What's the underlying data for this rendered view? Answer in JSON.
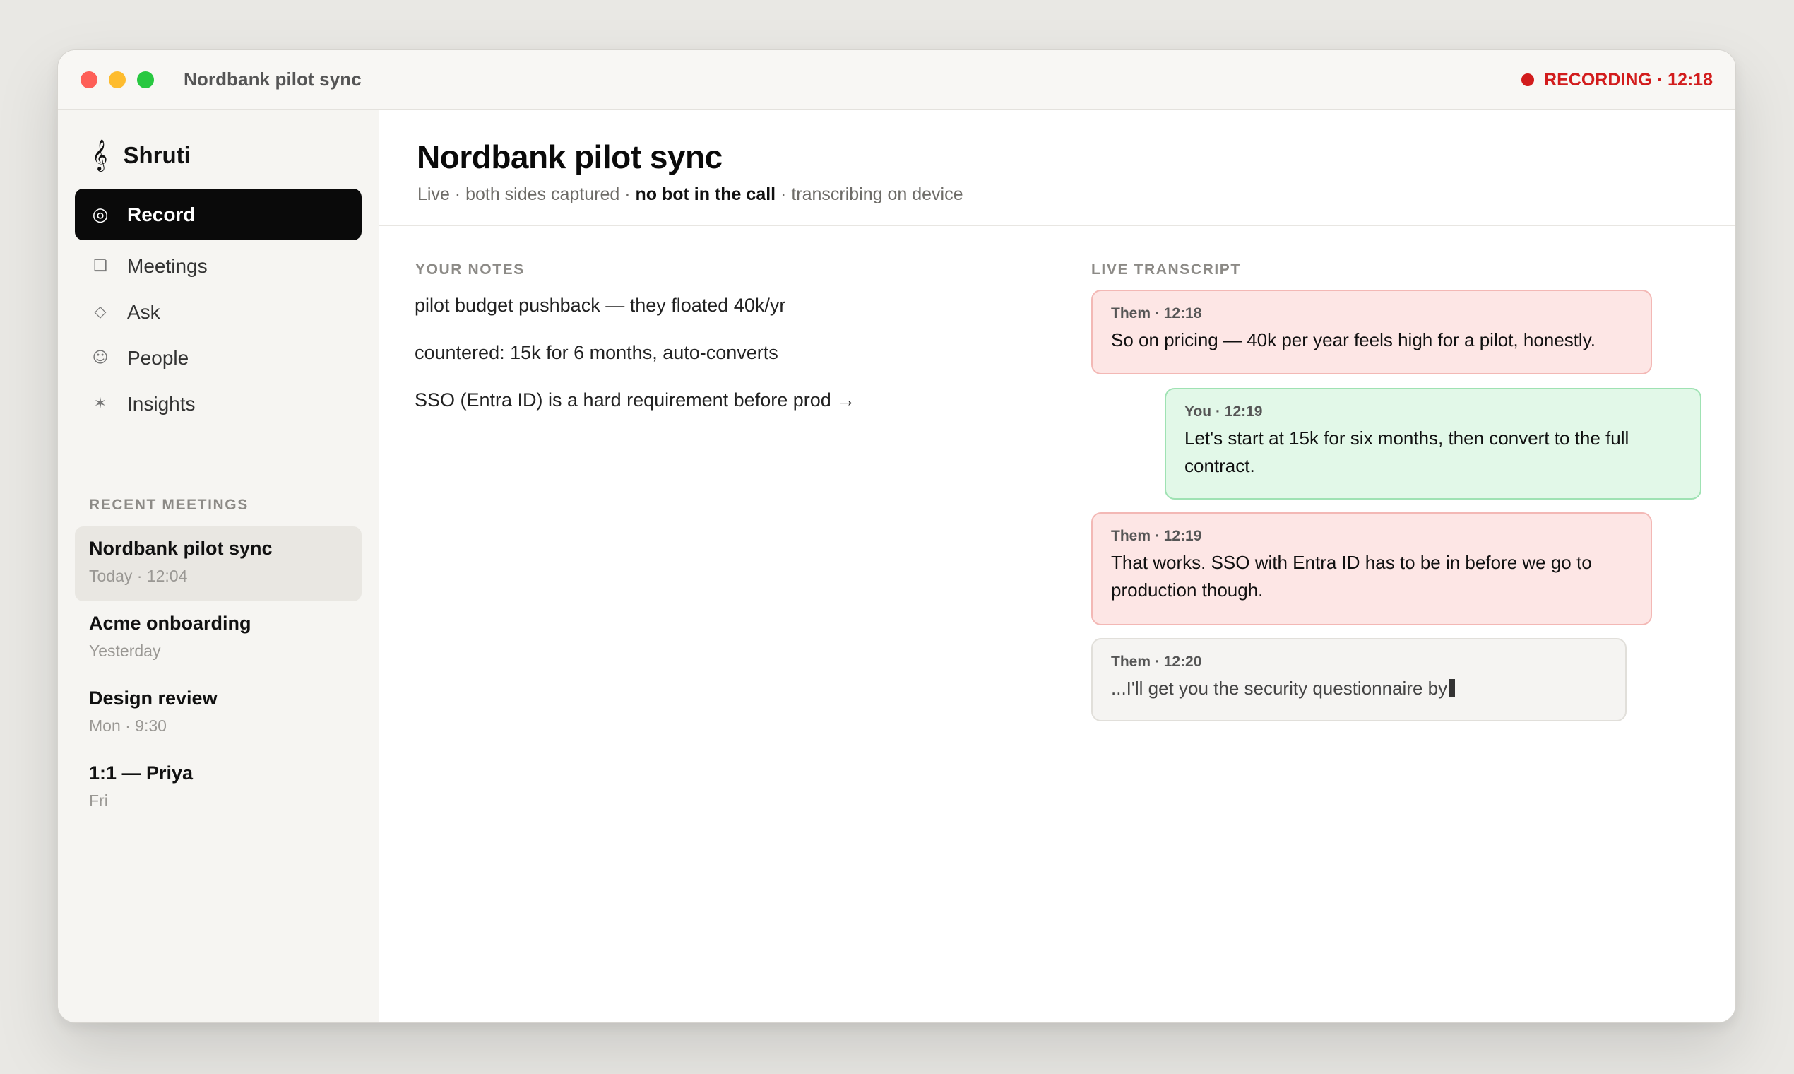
{
  "window": {
    "title": "Nordbank pilot sync",
    "recording": "RECORDING · 12:18"
  },
  "sidebar": {
    "brand": "Shruti",
    "brand_icon": "treble-clef-icon",
    "nav": [
      {
        "label": "Record",
        "icon": "record-icon",
        "glyph": "◎",
        "active": true
      },
      {
        "label": "Meetings",
        "icon": "meetings-icon",
        "glyph": "❏"
      },
      {
        "label": "Ask",
        "icon": "ask-icon",
        "glyph": "◇"
      },
      {
        "label": "People",
        "icon": "people-icon",
        "glyph": "☺"
      },
      {
        "label": "Insights",
        "icon": "insights-icon",
        "glyph": "✶"
      }
    ],
    "recent_label": "RECENT MEETINGS",
    "recent": [
      {
        "title": "Nordbank pilot sync",
        "sub": "Today · 12:04",
        "active": true
      },
      {
        "title": "Acme onboarding",
        "sub": "Yesterday"
      },
      {
        "title": "Design review",
        "sub": "Mon · 9:30"
      },
      {
        "title": "1:1 — Priya",
        "sub": "Fri"
      }
    ]
  },
  "main": {
    "title": "Nordbank pilot sync",
    "subtitle_a": "Live · both sides captured · ",
    "subtitle_b": "no bot in the call",
    "subtitle_c": " · transcribing on device",
    "notes_label": "YOUR NOTES",
    "notes": [
      "pilot budget pushback — they floated 40k/yr",
      "countered: 15k for 6 months, auto-converts",
      "SSO (Entra ID) is a hard requirement before prod →"
    ],
    "transcript_label": "LIVE TRANSCRIPT",
    "transcript": [
      {
        "meta": "Them · 12:18",
        "text": "So on pricing — 40k per year feels high for a pilot, honestly."
      },
      {
        "meta": "You · 12:19",
        "text": "Let's start at 15k for six months, then convert to the full contract."
      },
      {
        "meta": "Them · 12:19",
        "text": "That works. SSO with Entra ID has to be in before we go to production though."
      },
      {
        "meta": "Them · 12:20",
        "text": "...I'll get you the security questionnaire by"
      }
    ]
  },
  "colors": {
    "recording": "#d21c1c",
    "them_bg": "#fde6e5",
    "you_bg": "#e2f8e8"
  }
}
